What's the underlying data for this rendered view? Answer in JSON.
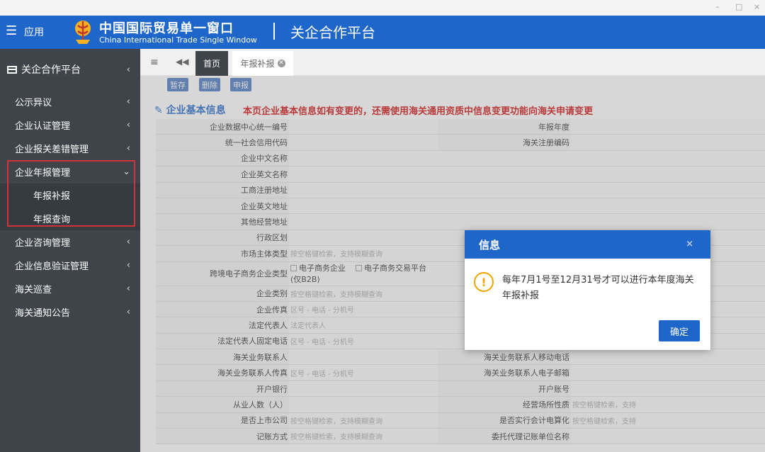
{
  "window": {
    "minimize": "–",
    "maximize": "□",
    "close": "×"
  },
  "header": {
    "apps_label": "应用",
    "brand_cn": "中国国际贸易单一窗口",
    "brand_en": "China International Trade Single Window",
    "platform_title": "关企合作平台"
  },
  "sidebar": {
    "title": "关企合作平台",
    "items": [
      {
        "label": "公示异议",
        "chevron": "‹"
      },
      {
        "label": "企业认证管理",
        "chevron": "‹"
      },
      {
        "label": "企业报关差错管理",
        "chevron": "‹"
      },
      {
        "label": "企业年报管理",
        "chevron": "⌄"
      },
      {
        "label": "年报补报"
      },
      {
        "label": "年报查询"
      },
      {
        "label": "企业咨询管理",
        "chevron": "‹"
      },
      {
        "label": "企业信息验证管理",
        "chevron": "‹"
      },
      {
        "label": "海关巡查",
        "chevron": "‹"
      },
      {
        "label": "海关通知公告",
        "chevron": "‹"
      }
    ]
  },
  "tabs": {
    "menu": "≡",
    "prev": "◀◀",
    "home": "首页",
    "annual": "年报补报"
  },
  "toolbar": {
    "save": "暂存",
    "delete": "删除",
    "submit": "申报"
  },
  "section": {
    "title": "企业基本信息",
    "notice": "本页企业基本信息如有变更的，还需使用海关通用资质中信息变更功能向海关申请变更"
  },
  "form": {
    "r1": {
      "label1": "企业数据中心统一编号",
      "label2": "年报年度"
    },
    "r2": {
      "label1": "统一社会信用代码",
      "label2": "海关注册编码"
    },
    "r3": {
      "label1": "企业中文名称"
    },
    "r4": {
      "label1": "企业英文名称"
    },
    "r5": {
      "label1": "工商注册地址"
    },
    "r6": {
      "label1": "企业英文地址"
    },
    "r7": {
      "label1": "其他经营地址"
    },
    "r8": {
      "label1": "行政区划"
    },
    "r9": {
      "label1": "市场主体类型",
      "value1": "按空格键检索，支持模糊查询"
    },
    "r10": {
      "label1": "跨境电子商务企业类型",
      "opt1": "电子商务企业",
      "opt1b": "(仅B2B)",
      "opt2": "电子商务交易平台"
    },
    "r11": {
      "label1": "企业类别",
      "value1": "按空格键检索，支持模糊查询"
    },
    "r12": {
      "label1": "企业传真",
      "value1": "区号  -  电话  -  分机号"
    },
    "r13": {
      "label1": "法定代表人",
      "value1": "法定代表人"
    },
    "r14": {
      "label1": "法定代表人固定电话",
      "value1": "区号  -  电话  -  分机号"
    },
    "r15": {
      "label1": "海关业务联系人",
      "label2": "海关业务联系人移动电话"
    },
    "r16": {
      "label1": "海关业务联系人传真",
      "value1": "区号  -  电话  -  分机号",
      "label2": "海关业务联系人电子邮箱"
    },
    "r17": {
      "label1": "开户银行",
      "label2": "开户账号"
    },
    "r18": {
      "label1": "从业人数（人）",
      "label2": "经营场所性质",
      "value2": "按空格键检索，支持"
    },
    "r19": {
      "label1": "是否上市公司",
      "value1": "按空格键检索，支持模糊查询",
      "label2": "是否实行会计电算化",
      "value2": "按空格键检索，支持"
    },
    "r20": {
      "label1": "记账方式",
      "value1": "按空格键检索，支持模糊查询",
      "label2": "委托代理记账单位名称"
    }
  },
  "dialog": {
    "title": "信息",
    "close": "×",
    "icon": "!",
    "message": "每年7月1号至12月31号才可以进行本年度海关年报补报",
    "ok": "确定"
  }
}
